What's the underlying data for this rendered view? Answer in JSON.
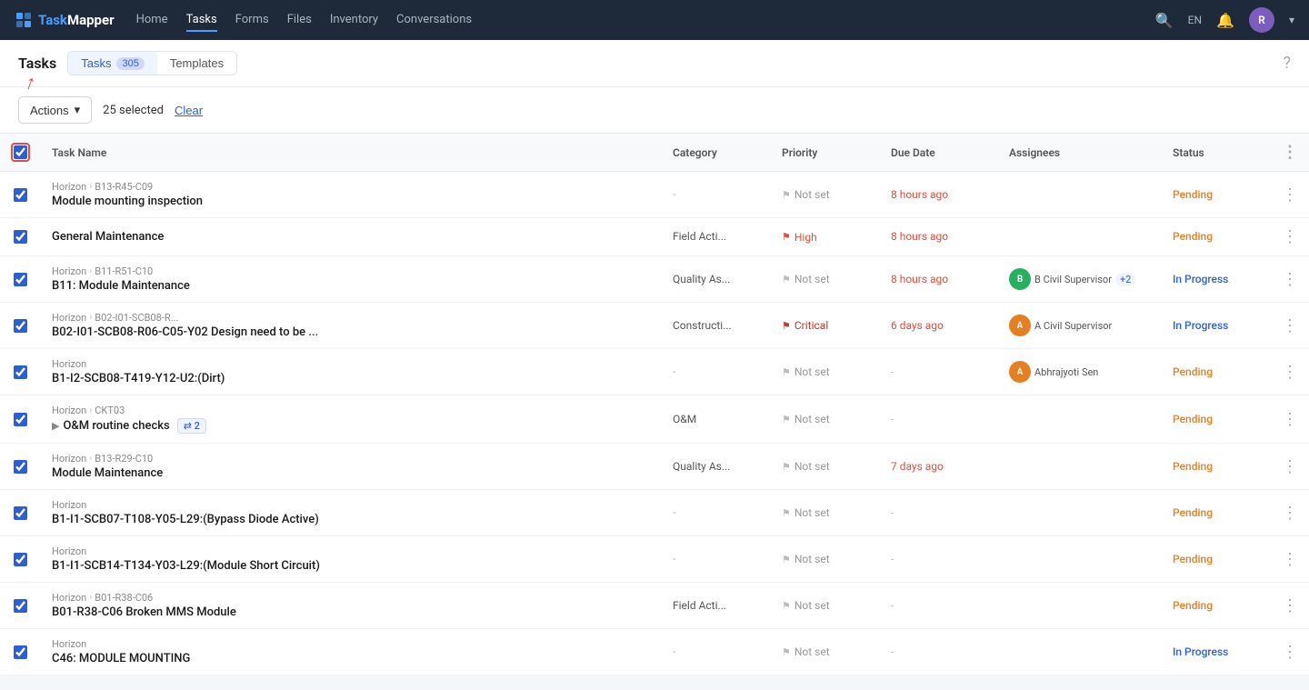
{
  "app": {
    "name": "TaskMapper",
    "logo_letter": "T"
  },
  "nav": {
    "links": [
      {
        "id": "home",
        "label": "Home",
        "active": false
      },
      {
        "id": "tasks",
        "label": "Tasks",
        "active": true
      },
      {
        "id": "forms",
        "label": "Forms",
        "active": false
      },
      {
        "id": "files",
        "label": "Files",
        "active": false
      },
      {
        "id": "inventory",
        "label": "Inventory",
        "active": false
      },
      {
        "id": "conversations",
        "label": "Conversations",
        "active": false
      }
    ],
    "lang": "EN",
    "user_initial": "R"
  },
  "page": {
    "title": "Tasks",
    "help_icon": "?",
    "tabs": [
      {
        "id": "tasks",
        "label": "Tasks",
        "count": "305",
        "active": true
      },
      {
        "id": "templates",
        "label": "Templates",
        "count": "",
        "active": false
      }
    ]
  },
  "toolbar": {
    "actions_label": "Actions",
    "selected_text": "25 selected",
    "clear_label": "Clear"
  },
  "table": {
    "columns": [
      {
        "id": "checkbox",
        "label": ""
      },
      {
        "id": "taskname",
        "label": "Task Name"
      },
      {
        "id": "category",
        "label": "Category"
      },
      {
        "id": "priority",
        "label": "Priority"
      },
      {
        "id": "duedate",
        "label": "Due Date"
      },
      {
        "id": "assignees",
        "label": "Assignees"
      },
      {
        "id": "status",
        "label": "Status"
      },
      {
        "id": "actions",
        "label": ""
      }
    ],
    "rows": [
      {
        "id": 1,
        "breadcrumb": "Horizon › B13-R45-C09",
        "task_name": "Module mounting inspection",
        "category": "-",
        "priority": "Not set",
        "priority_type": "notset",
        "due_date": "8 hours ago",
        "due_type": "overdue",
        "assignees": [],
        "status": "Pending",
        "status_type": "pending",
        "checked": true,
        "has_expand": false,
        "subtask_count": 0
      },
      {
        "id": 2,
        "breadcrumb": "",
        "task_name": "General Maintenance",
        "category": "Field Acti...",
        "priority": "High",
        "priority_type": "high",
        "due_date": "8 hours ago",
        "due_type": "overdue",
        "assignees": [],
        "status": "Pending",
        "status_type": "pending",
        "checked": true,
        "has_expand": false,
        "subtask_count": 0
      },
      {
        "id": 3,
        "breadcrumb": "Horizon › B11-R51-C10",
        "task_name": "B11: Module Maintenance",
        "category": "Quality As...",
        "priority": "Not set",
        "priority_type": "notset",
        "due_date": "8 hours ago",
        "due_type": "overdue",
        "assignees": [
          {
            "label": "B",
            "color": "#27ae60",
            "name": "B Civil Supervisor"
          }
        ],
        "assignee_extra": "+2",
        "status": "In Progress",
        "status_type": "inprogress",
        "checked": true,
        "has_expand": false,
        "subtask_count": 0
      },
      {
        "id": 4,
        "breadcrumb": "Horizon › B02-I01-SCB08-R...",
        "task_name": "B02-I01-SCB08-R06-C05-Y02 Design need to be ...",
        "category": "Constructi...",
        "priority": "Critical",
        "priority_type": "critical",
        "due_date": "6 days ago",
        "due_type": "overdue",
        "assignees": [
          {
            "label": "A",
            "color": "#e67e22",
            "name": "A Civil Supervisor"
          }
        ],
        "assignee_extra": "",
        "status": "In Progress",
        "status_type": "inprogress",
        "checked": true,
        "has_expand": false,
        "subtask_count": 0
      },
      {
        "id": 5,
        "breadcrumb": "Horizon",
        "task_name": "B1-I2-SCB08-T419-Y12-U2:(Dirt)",
        "category": "-",
        "priority": "Not set",
        "priority_type": "notset",
        "due_date": "-",
        "due_type": "dash",
        "assignees": [
          {
            "label": "A",
            "color": "#e67e22",
            "name": "Abhrajyoti Sen"
          }
        ],
        "assignee_extra": "",
        "status": "Pending",
        "status_type": "pending",
        "checked": true,
        "has_expand": false,
        "subtask_count": 0
      },
      {
        "id": 6,
        "breadcrumb": "Horizon › CKT03",
        "task_name": "O&M routine checks",
        "category": "O&M",
        "priority": "Not set",
        "priority_type": "notset",
        "due_date": "-",
        "due_type": "dash",
        "assignees": [],
        "status": "Pending",
        "status_type": "pending",
        "checked": true,
        "has_expand": true,
        "subtask_count": 2
      },
      {
        "id": 7,
        "breadcrumb": "Horizon › B13-R29-C10",
        "task_name": "Module Maintenance",
        "category": "Quality As...",
        "priority": "Not set",
        "priority_type": "notset",
        "due_date": "7 days ago",
        "due_type": "overdue",
        "assignees": [],
        "status": "Pending",
        "status_type": "pending",
        "checked": true,
        "has_expand": false,
        "subtask_count": 0
      },
      {
        "id": 8,
        "breadcrumb": "Horizon",
        "task_name": "B1-I1-SCB07-T108-Y05-L29:(Bypass Diode Active)",
        "category": "-",
        "priority": "Not set",
        "priority_type": "notset",
        "due_date": "-",
        "due_type": "dash",
        "assignees": [],
        "status": "Pending",
        "status_type": "pending",
        "checked": true,
        "has_expand": false,
        "subtask_count": 0
      },
      {
        "id": 9,
        "breadcrumb": "Horizon",
        "task_name": "B1-I1-SCB14-T134-Y03-L29:(Module Short Circuit)",
        "category": "-",
        "priority": "Not set",
        "priority_type": "notset",
        "due_date": "-",
        "due_type": "dash",
        "assignees": [],
        "status": "Pending",
        "status_type": "pending",
        "checked": true,
        "has_expand": false,
        "subtask_count": 0
      },
      {
        "id": 10,
        "breadcrumb": "Horizon › B01-R38-C06",
        "task_name": "B01-R38-C06 Broken MMS Module",
        "category": "Field Acti...",
        "priority": "Not set",
        "priority_type": "notset",
        "due_date": "-",
        "due_type": "dash",
        "assignees": [],
        "status": "Pending",
        "status_type": "pending",
        "checked": true,
        "has_expand": false,
        "subtask_count": 0
      },
      {
        "id": 11,
        "breadcrumb": "Horizon",
        "task_name": "C46: MODULE MOUNTING",
        "category": "-",
        "priority": "Not set",
        "priority_type": "notset",
        "due_date": "-",
        "due_type": "dash",
        "assignees": [],
        "status": "In Progress",
        "status_type": "inprogress",
        "checked": true,
        "has_expand": false,
        "subtask_count": 0
      }
    ]
  }
}
